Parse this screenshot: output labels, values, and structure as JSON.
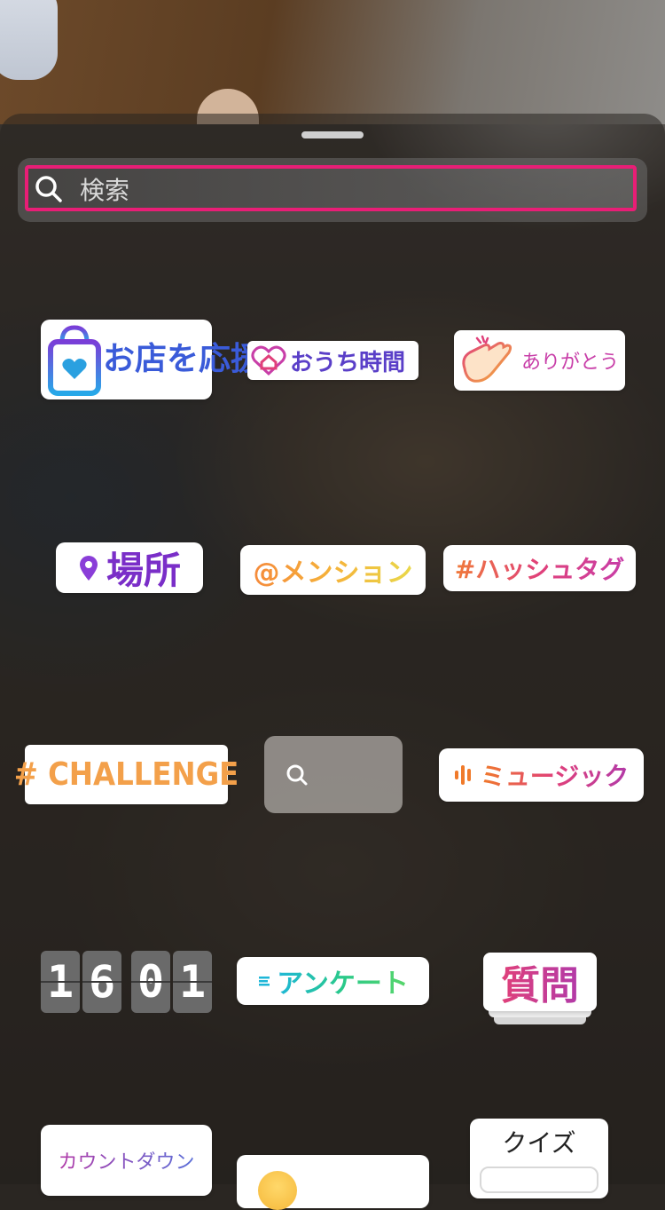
{
  "search": {
    "placeholder": "検索"
  },
  "stickers": {
    "shop": "お店を応援",
    "stay_home": "おうち時間",
    "thanks": "ありがとう",
    "location": "場所",
    "mention": "@メンション",
    "hashtag": "#ハッシュタグ",
    "challenge": "# CHALLENGE",
    "music": "ミュージック",
    "clock_digits": [
      "1",
      "6",
      "0",
      "1"
    ],
    "poll": "アンケート",
    "question": "質問",
    "countdown": "カウントダウン",
    "quiz": "クイズ"
  },
  "colors": {
    "search_highlight": "#e81e76",
    "shop_text": "#3a5bd9",
    "location_text": "#7a2ec8"
  }
}
